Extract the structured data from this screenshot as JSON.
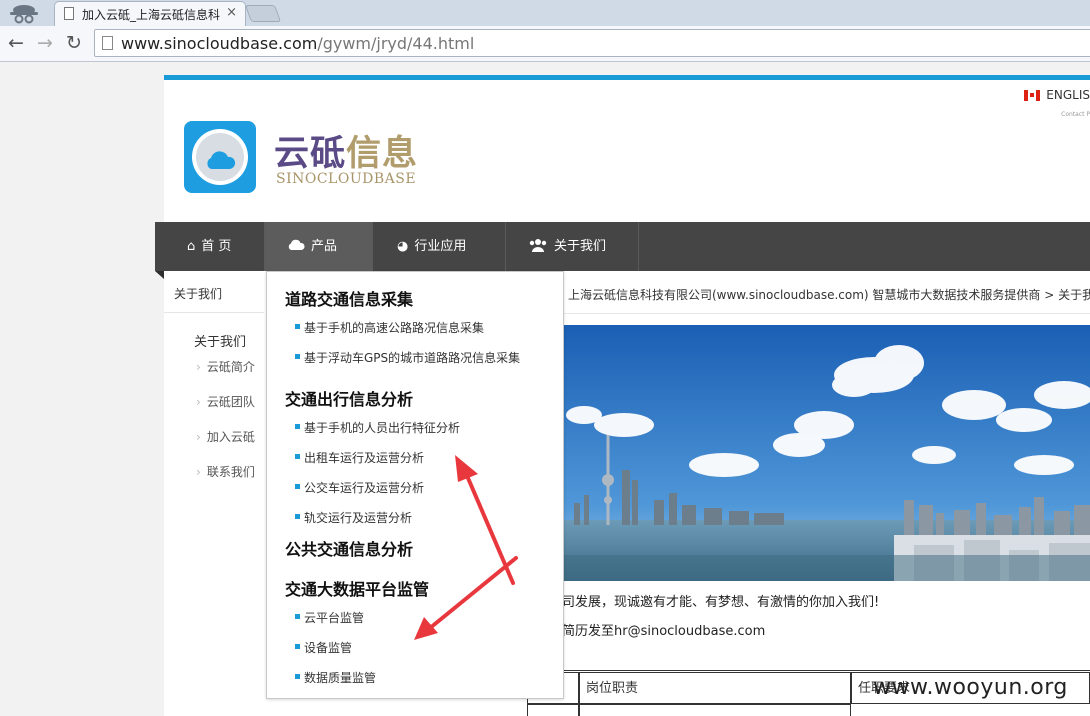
{
  "browser": {
    "tab_title": "加入云砥_上海云砥信息科",
    "tab_close": "×",
    "url_host": "www.sinocloudbase.com",
    "url_path": "/gywm/jryd/44.html",
    "back": "←",
    "forward": "→",
    "reload": "↻"
  },
  "header": {
    "lang": "ENGLIS",
    "contact": "Contact P",
    "brand_cn_a": "云砥",
    "brand_cn_b": "信息",
    "brand_en": "SINOCLOUDBASE"
  },
  "nav": {
    "items": [
      {
        "label": "首 页",
        "icon": "home-icon"
      },
      {
        "label": "产品",
        "icon": "cloud-icon"
      },
      {
        "label": "行业应用",
        "icon": "globe-icon"
      },
      {
        "label": "关于我们",
        "icon": "users-icon"
      }
    ]
  },
  "sidebar": {
    "title": "关于我们",
    "head": "关于我们",
    "items": [
      "云砥简介",
      "云砥团队",
      "加入云砥",
      "联系我们"
    ]
  },
  "breadcrumb": "上海云砥信息科技有限公司(www.sinocloudbase.com) 智慧城市大数据技术服务提供商 > 关于我们",
  "dropdown": {
    "cat1": "道路交通信息采集",
    "cat1_items": [
      "基于手机的高速公路路况信息采集",
      "基于浮动车GPS的城市道路路况信息采集"
    ],
    "cat2": "交通出行信息分析",
    "cat2_items": [
      "基于手机的人员出行特征分析",
      "出租车运行及运营分析",
      "公交车运行及运营分析",
      "轨交运行及运营分析"
    ],
    "cat3": "公共交通信息分析",
    "cat4": "交通大数据平台监管",
    "cat4_items": [
      "云平台监管",
      "设备监管",
      "数据质量监管"
    ]
  },
  "content": {
    "p1": "司发展，现诚邀有才能、有梦想、有激情的你加入我们!",
    "p2": "简历发至hr@sinocloudbase.com",
    "table_col1": "岗位职责",
    "table_col2": "任职要求"
  },
  "watermark": "www.wooyun.org",
  "colors": {
    "accent": "#1a9bd8",
    "nav_bg": "#454545",
    "arrow": "#e8383d"
  }
}
